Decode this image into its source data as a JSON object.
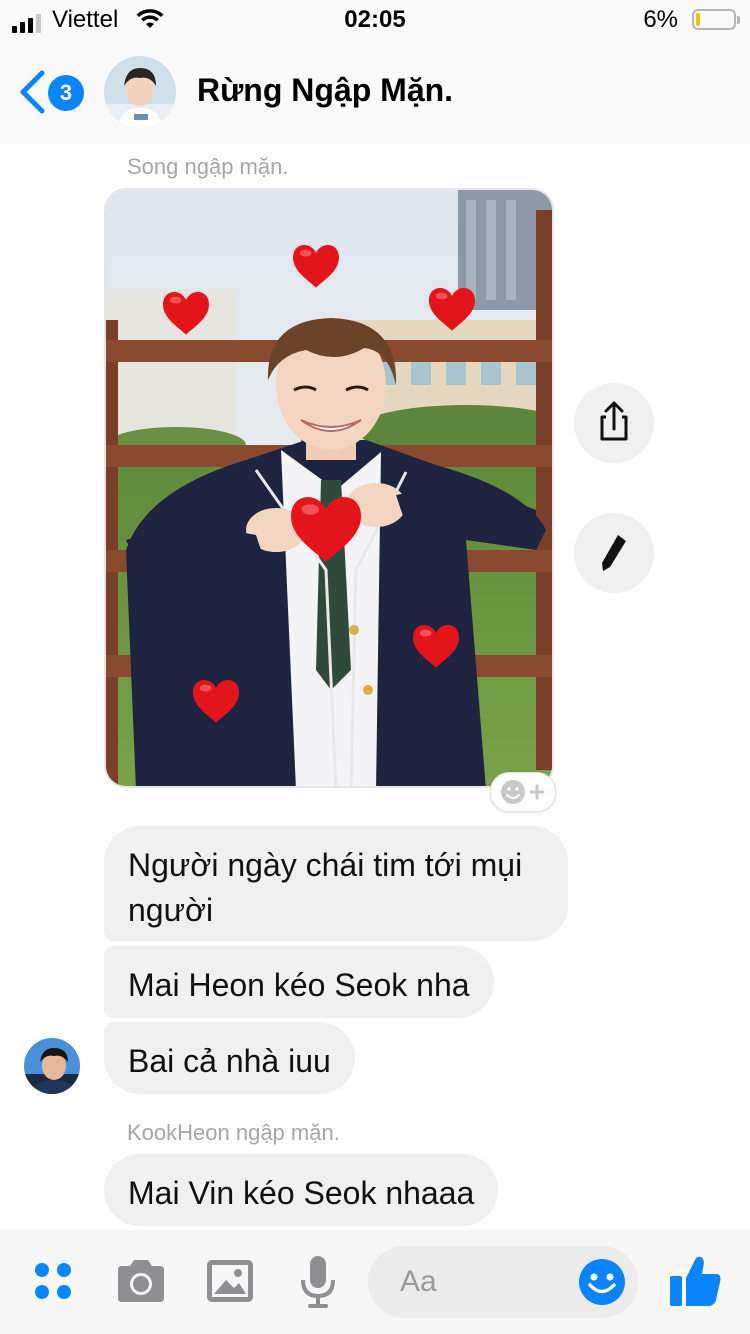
{
  "status_bar": {
    "carrier": "Viettel",
    "time": "02:05",
    "battery_percent": "6%",
    "battery_level": 0.06,
    "signal_bars": 3,
    "wifi_icon": "wifi-icon"
  },
  "header": {
    "unread_count": "3",
    "title": "Rừng Ngập Mặn.",
    "back_icon": "chevron-left-icon"
  },
  "messages": {
    "sender_1": "Song ngập mặn.",
    "sender_2": "KookHeon ngập mặn.",
    "bubbles": [
      "Người ngày chái tim tới mụi người",
      "Mai Heon kéo Seok nha",
      "Bai cả nhà iuu",
      "Mai Vin kéo Seok nhaaa"
    ]
  },
  "composer": {
    "placeholder": "Aa",
    "icons": [
      "apps-icon",
      "camera-icon",
      "gallery-icon",
      "microphone-icon",
      "emoji-icon",
      "thumbs-up-icon"
    ]
  },
  "colors": {
    "accent": "#0a84ff",
    "bubble": "#f0f0f0",
    "heart": "#e3151b"
  }
}
